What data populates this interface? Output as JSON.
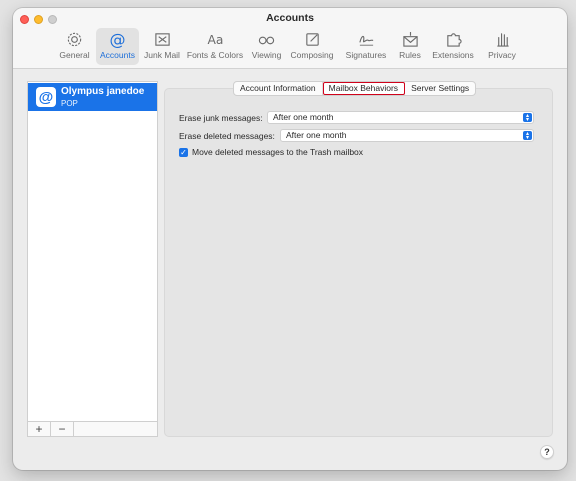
{
  "window": {
    "title": "Accounts"
  },
  "toolbar": {
    "tabs": [
      {
        "id": "general",
        "label": "General",
        "icon": "gear-icon"
      },
      {
        "id": "accounts",
        "label": "Accounts",
        "icon": "at-sign-icon",
        "active": true
      },
      {
        "id": "junk",
        "label": "Junk Mail",
        "icon": "junk-tray-icon"
      },
      {
        "id": "fonts",
        "label": "Fonts & Colors",
        "icon": "font-aa-icon"
      },
      {
        "id": "viewing",
        "label": "Viewing",
        "icon": "glasses-icon"
      },
      {
        "id": "composing",
        "label": "Composing",
        "icon": "compose-icon"
      },
      {
        "id": "signatures",
        "label": "Signatures",
        "icon": "signature-icon"
      },
      {
        "id": "rules",
        "label": "Rules",
        "icon": "envelope-rules-icon"
      },
      {
        "id": "extensions",
        "label": "Extensions",
        "icon": "puzzle-icon"
      },
      {
        "id": "privacy",
        "label": "Privacy",
        "icon": "hand-icon"
      }
    ]
  },
  "sidebar": {
    "accounts": [
      {
        "name": "Olympus janedoe",
        "type": "POP",
        "icon": "at-sign-icon"
      }
    ],
    "add_label": "+",
    "remove_label": "−"
  },
  "segments": [
    "Account Information",
    "Mailbox Behaviors",
    "Server Settings"
  ],
  "selected_segment": "Mailbox Behaviors",
  "form": {
    "erase_junk": {
      "label": "Erase junk messages:",
      "value": "After one month"
    },
    "erase_deleted": {
      "label": "Erase deleted messages:",
      "value": "After one month"
    },
    "move_deleted": {
      "label": "Move deleted messages to the Trash mailbox",
      "checked": true
    }
  },
  "help_label": "?",
  "colors": {
    "accent": "#1a73e8",
    "highlight_outline": "#d0021b"
  }
}
